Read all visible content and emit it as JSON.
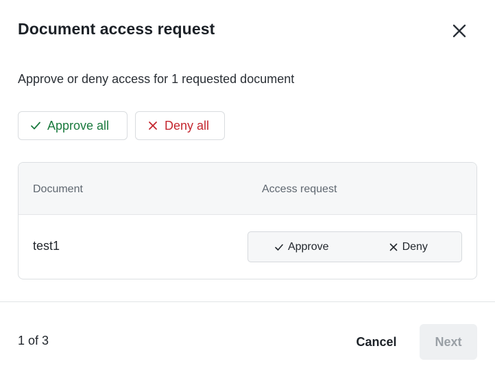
{
  "dialog": {
    "title": "Document access request",
    "subtitle": "Approve or deny access for 1 requested document"
  },
  "bulk_actions": {
    "approve_all_label": "Approve all",
    "deny_all_label": "Deny all"
  },
  "table": {
    "columns": [
      "Document",
      "Access request"
    ],
    "rows": [
      {
        "document": "test1",
        "approve_label": "Approve",
        "deny_label": "Deny"
      }
    ]
  },
  "footer": {
    "pagination": "1 of 3",
    "cancel_label": "Cancel",
    "next_label": "Next"
  },
  "icons": {
    "close": "close-icon",
    "approve": "checkmark-icon",
    "deny": "x-icon"
  },
  "colors": {
    "approve": "#1a7a3e",
    "deny": "#c4262e",
    "disabled_button_bg": "#eef0f2",
    "disabled_button_text": "#9aa0a6"
  }
}
